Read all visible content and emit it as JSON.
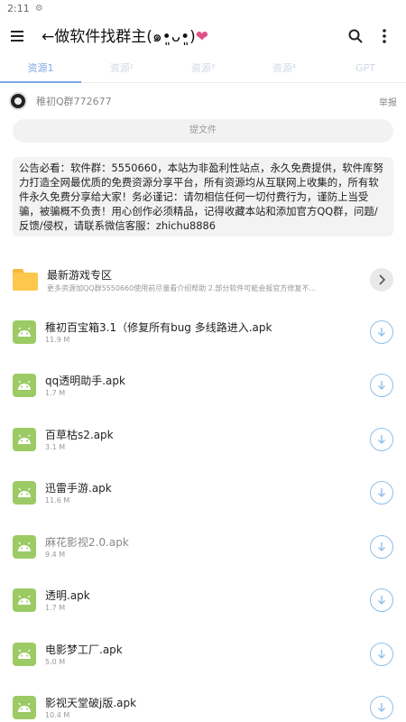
{
  "statusbar": {
    "time": "2:11"
  },
  "appbar": {
    "title": "←做软件找群主(๑•͈ᴗ•͈)",
    "heart": "❤"
  },
  "tabs": [
    {
      "label": "资源1",
      "active": true
    },
    {
      "label": "资源²",
      "active": false
    },
    {
      "label": "资源³",
      "active": false
    },
    {
      "label": "资源⁴",
      "active": false
    },
    {
      "label": "GPT",
      "active": false
    }
  ],
  "user": {
    "name": "稚初Q群772677",
    "report_label": "举报"
  },
  "submit_label": "提文件",
  "notice": "公告必看：软件群：5550660，本站为非盈利性站点，永久免费提供，软件库努力打造全网最优质的免费资源分享平台，所有资源均从互联网上收集的，所有软件永久免费分享给大家！务必谨记：请勿相信任何一切付费行为，谨防上当受骗，被骗概不负责！用心创作必须精品，记得收藏本站和添加官方QQ群，问题/反馈/侵权，请联系微信客服：zhichu8886",
  "folder": {
    "name": "最新游戏专区",
    "desc": "更多资源加QQ群5550660使用前尽量看介绍帮助 2.部分软件可能会报官方修复不..."
  },
  "files": [
    {
      "name": "稚初百宝箱3.1（修复所有bug 多线路进入.apk",
      "size": "11.9 M"
    },
    {
      "name": "qq透明助手.apk",
      "size": "1.7 M"
    },
    {
      "name": "百草枯s2.apk",
      "size": "3.1 M"
    },
    {
      "name": "迅雷手游.apk",
      "size": "11.6 M"
    },
    {
      "name": "麻花影视2.0.apk",
      "size": "9.4 M"
    },
    {
      "name": "透明.apk",
      "size": "1.7 M"
    },
    {
      "name": "电影梦工厂.apk",
      "size": "5.0 M"
    },
    {
      "name": "影视天堂破j版.apk",
      "size": "10.4 M"
    }
  ],
  "colors": {
    "accent": "#7da6e6",
    "apk": "#9ccb65",
    "folder": "#fdc74d",
    "download": "#8ec0ea"
  }
}
